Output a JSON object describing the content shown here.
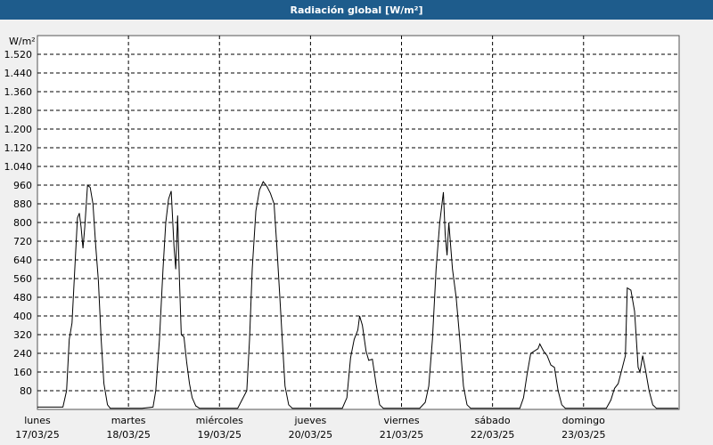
{
  "header": {
    "title": "Radiación global [W/m²]"
  },
  "chart_data": {
    "type": "line",
    "title": "Radiación global [W/m²]",
    "ylabel": "W/m²",
    "ylim": [
      0,
      1600
    ],
    "yticks": [
      "1.520",
      "1.440",
      "1.360",
      "1.280",
      "1.200",
      "1.120",
      "1.040",
      "960",
      "880",
      "800",
      "720",
      "640",
      "560",
      "480",
      "400",
      "320",
      "240",
      "160",
      "80"
    ],
    "ytick_values": [
      1520,
      1440,
      1360,
      1280,
      1200,
      1120,
      1040,
      960,
      880,
      800,
      720,
      640,
      560,
      480,
      400,
      320,
      240,
      160,
      80
    ],
    "days": [
      {
        "name": "lunes",
        "date": "17/03/25"
      },
      {
        "name": "martes",
        "date": "18/03/25"
      },
      {
        "name": "miércoles",
        "date": "19/03/25"
      },
      {
        "name": "jueves",
        "date": "20/03/25"
      },
      {
        "name": "viernes",
        "date": "21/03/25"
      },
      {
        "name": "sábado",
        "date": "22/03/25"
      },
      {
        "name": "domingo",
        "date": "23/03/25"
      }
    ],
    "xlim_days": [
      0,
      7.05
    ],
    "grid": true,
    "series": [
      {
        "color": "#000000",
        "points": [
          [
            0.0,
            10
          ],
          [
            0.28,
            10
          ],
          [
            0.32,
            80
          ],
          [
            0.35,
            300
          ],
          [
            0.38,
            370
          ],
          [
            0.41,
            600
          ],
          [
            0.44,
            820
          ],
          [
            0.46,
            840
          ],
          [
            0.48,
            780
          ],
          [
            0.5,
            690
          ],
          [
            0.52,
            780
          ],
          [
            0.55,
            960
          ],
          [
            0.58,
            950
          ],
          [
            0.61,
            880
          ],
          [
            0.64,
            700
          ],
          [
            0.67,
            550
          ],
          [
            0.7,
            300
          ],
          [
            0.73,
            110
          ],
          [
            0.77,
            20
          ],
          [
            0.8,
            5
          ],
          [
            0.88,
            5
          ],
          [
            0.91,
            5
          ],
          [
            1.15,
            5
          ],
          [
            1.27,
            10
          ],
          [
            1.3,
            80
          ],
          [
            1.34,
            300
          ],
          [
            1.38,
            600
          ],
          [
            1.41,
            800
          ],
          [
            1.44,
            900
          ],
          [
            1.47,
            935
          ],
          [
            1.5,
            700
          ],
          [
            1.52,
            600
          ],
          [
            1.54,
            830
          ],
          [
            1.56,
            560
          ],
          [
            1.58,
            320
          ],
          [
            1.61,
            310
          ],
          [
            1.64,
            200
          ],
          [
            1.67,
            110
          ],
          [
            1.7,
            50
          ],
          [
            1.74,
            15
          ],
          [
            1.78,
            5
          ],
          [
            2.2,
            5
          ],
          [
            2.3,
            80
          ],
          [
            2.33,
            300
          ],
          [
            2.36,
            600
          ],
          [
            2.4,
            850
          ],
          [
            2.44,
            940
          ],
          [
            2.48,
            975
          ],
          [
            2.52,
            955
          ],
          [
            2.56,
            925
          ],
          [
            2.6,
            880
          ],
          [
            2.63,
            700
          ],
          [
            2.66,
            500
          ],
          [
            2.69,
            300
          ],
          [
            2.72,
            100
          ],
          [
            2.76,
            20
          ],
          [
            2.8,
            5
          ],
          [
            3.35,
            5
          ],
          [
            3.4,
            50
          ],
          [
            3.44,
            220
          ],
          [
            3.48,
            300
          ],
          [
            3.52,
            340
          ],
          [
            3.54,
            400
          ],
          [
            3.57,
            360
          ],
          [
            3.61,
            250
          ],
          [
            3.64,
            210
          ],
          [
            3.68,
            215
          ],
          [
            3.72,
            110
          ],
          [
            3.76,
            20
          ],
          [
            3.8,
            5
          ],
          [
            4.2,
            5
          ],
          [
            4.26,
            30
          ],
          [
            4.3,
            100
          ],
          [
            4.34,
            300
          ],
          [
            4.38,
            600
          ],
          [
            4.42,
            800
          ],
          [
            4.46,
            930
          ],
          [
            4.48,
            750
          ],
          [
            4.5,
            660
          ],
          [
            4.52,
            800
          ],
          [
            4.56,
            600
          ],
          [
            4.6,
            480
          ],
          [
            4.64,
            300
          ],
          [
            4.68,
            100
          ],
          [
            4.72,
            20
          ],
          [
            4.76,
            5
          ],
          [
            5.3,
            5
          ],
          [
            5.34,
            50
          ],
          [
            5.38,
            150
          ],
          [
            5.42,
            240
          ],
          [
            5.46,
            250
          ],
          [
            5.5,
            260
          ],
          [
            5.52,
            280
          ],
          [
            5.56,
            250
          ],
          [
            5.6,
            230
          ],
          [
            5.64,
            190
          ],
          [
            5.68,
            180
          ],
          [
            5.72,
            80
          ],
          [
            5.76,
            20
          ],
          [
            5.8,
            5
          ],
          [
            6.25,
            5
          ],
          [
            6.3,
            40
          ],
          [
            6.34,
            90
          ],
          [
            6.38,
            110
          ],
          [
            6.42,
            170
          ],
          [
            6.46,
            230
          ],
          [
            6.48,
            520
          ],
          [
            6.52,
            510
          ],
          [
            6.56,
            420
          ],
          [
            6.6,
            180
          ],
          [
            6.62,
            160
          ],
          [
            6.65,
            230
          ],
          [
            6.68,
            170
          ],
          [
            6.72,
            80
          ],
          [
            6.76,
            20
          ],
          [
            6.8,
            5
          ],
          [
            7.04,
            5
          ]
        ]
      }
    ]
  }
}
